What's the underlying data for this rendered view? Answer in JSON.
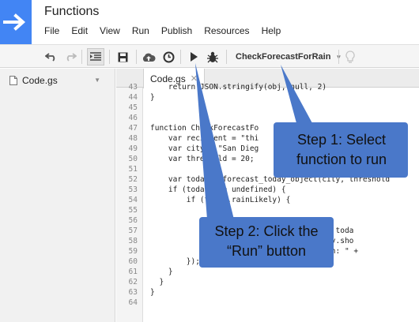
{
  "header": {
    "title": "Functions",
    "menu": [
      "File",
      "Edit",
      "View",
      "Run",
      "Publish",
      "Resources",
      "Help"
    ]
  },
  "toolbar": {
    "function_select": "CheckForecastForRain",
    "buttons": [
      "undo-icon",
      "redo-icon",
      "indent-icon",
      "save-icon",
      "cloud-upload-icon",
      "clock-icon",
      "run-icon",
      "debug-icon",
      "lightbulb-icon"
    ]
  },
  "sidebar": {
    "file": "Code.gs"
  },
  "editor": {
    "tab": "Code.gs",
    "lines": [
      {
        "n": "43",
        "text": "    return JSON.stringify(obj, null, 2)"
      },
      {
        "n": "44",
        "text": "}"
      },
      {
        "n": "45",
        "text": ""
      },
      {
        "n": "46",
        "text": ""
      },
      {
        "n": "47",
        "text": "function CheckForecastFo"
      },
      {
        "n": "48",
        "text": "    var recipient = \"thi"
      },
      {
        "n": "49",
        "text": "    var city = \"San Dieg"
      },
      {
        "n": "50",
        "text": "    var threshold = 20;"
      },
      {
        "n": "51",
        "text": ""
      },
      {
        "n": "52",
        "text": "    var today = forecast_today_object(city, threshold"
      },
      {
        "n": "53",
        "text": "    if (today !== undefined) {"
      },
      {
        "n": "54",
        "text": "        if (today.rainLikely) {"
      },
      {
        "n": "55",
        "text": ""
      },
      {
        "n": "56",
        "text": ""
      },
      {
        "n": "57",
        "text": "                            n today (\" + toda"
      },
      {
        "n": "58",
        "text": "                            ast:\" + today.sho"
      },
      {
        "n": "59",
        "text": "                            y) + \" ~ Rain: \" +"
      },
      {
        "n": "60",
        "text": "        });"
      },
      {
        "n": "61",
        "text": "    }"
      },
      {
        "n": "62",
        "text": "  }"
      },
      {
        "n": "63",
        "text": "}"
      },
      {
        "n": "64",
        "text": ""
      }
    ]
  },
  "callouts": {
    "step1": [
      "Step 1: Select",
      "function to run"
    ],
    "step2": [
      "Step 2: Click the",
      "“Run” button"
    ],
    "color": "#4a78c9"
  }
}
